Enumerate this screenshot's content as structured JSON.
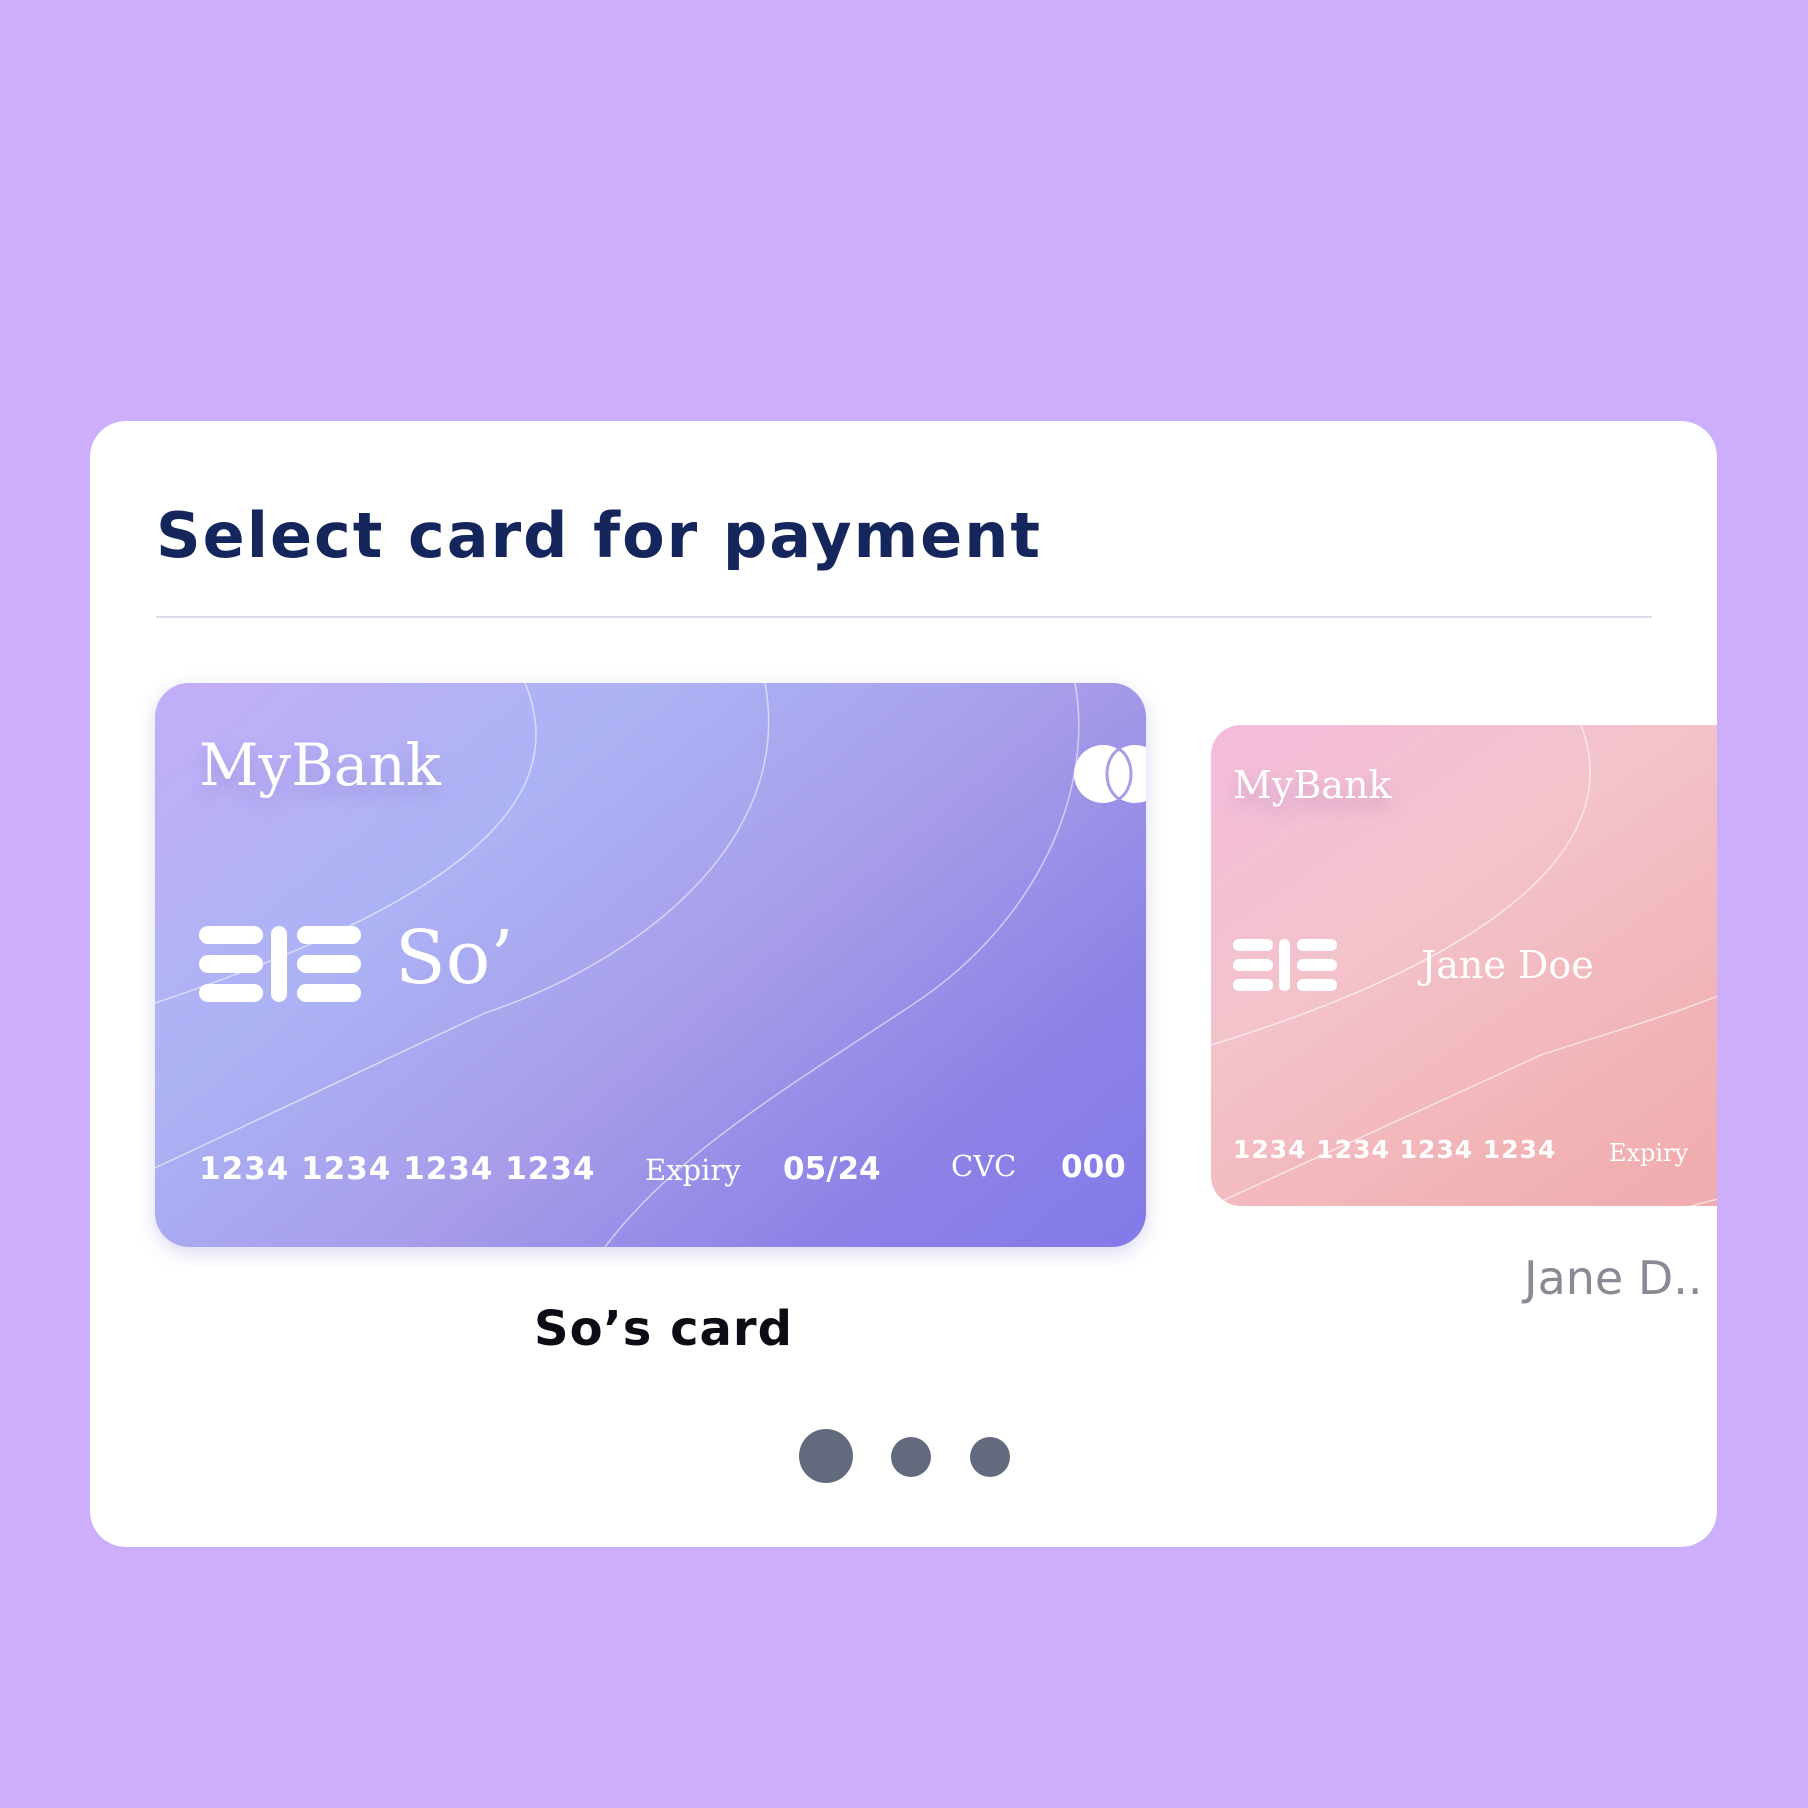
{
  "page": {
    "title": "Select card for payment",
    "background_color": "#cdaefa",
    "title_color": "#14265c"
  },
  "cards": [
    {
      "bank_name": "MyBank",
      "holder_name": "So’",
      "number": "1234 1234 1234 1234",
      "expiry_label": "Expiry",
      "expiry_value": "05/24",
      "cvc_label": "CVC",
      "cvc_value": "000",
      "caption": "So’s card",
      "brand_icon": "card-network-logo-icon",
      "chip_icon": "chip-icon",
      "colors": [
        "#c3aef8",
        "#acb3f5",
        "#847ae8"
      ]
    },
    {
      "bank_name": "MyBank",
      "holder_name": "Jane Doe",
      "number": "1234 1234 1234 1234",
      "expiry_label": "Expiry",
      "caption": "Jane D..",
      "chip_icon": "chip-icon",
      "colors": [
        "#f4bcdc",
        "#f3c3cc",
        "#f0a8ab"
      ]
    }
  ],
  "pagination": {
    "count": 3,
    "active_index": 0,
    "color": "#636a7e"
  }
}
